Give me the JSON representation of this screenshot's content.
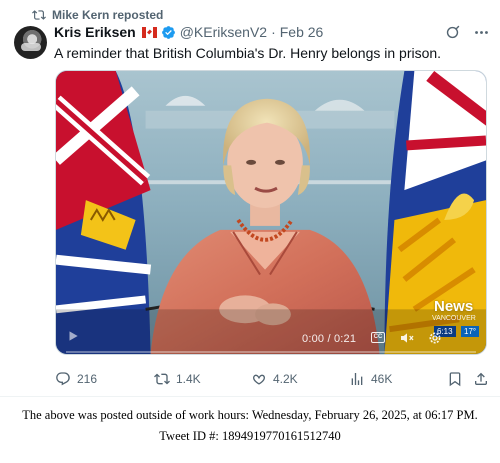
{
  "repost": {
    "text": "Mike Kern reposted"
  },
  "tweet": {
    "author_name": "Kris Eriksen",
    "handle": "@KEriksenV2",
    "separator": "·",
    "date": "Feb 26",
    "text": "A reminder that British Columbia's Dr. Henry belongs in prison.",
    "author_flag": "canada-flag"
  },
  "video": {
    "time": "0:00 / 0:21",
    "cc": "CC",
    "progress": 0.0,
    "overlay_brand": "News",
    "overlay_brand_sub": "VANCOUVER",
    "overlay_time": "6:13",
    "overlay_temp": "17°"
  },
  "actions": {
    "replies": "216",
    "reposts": "1.4K",
    "likes": "4.2K",
    "views": "46K"
  },
  "footer": {
    "line1": "The above was posted outside of work hours: Wednesday, February 26, 2025, at 06:17 PM.",
    "line2": "Tweet ID #: 1894919770161512740"
  },
  "colors": {
    "text_primary": "#0f1419",
    "text_secondary": "#536471",
    "verified_blue": "#1d9bf0"
  }
}
